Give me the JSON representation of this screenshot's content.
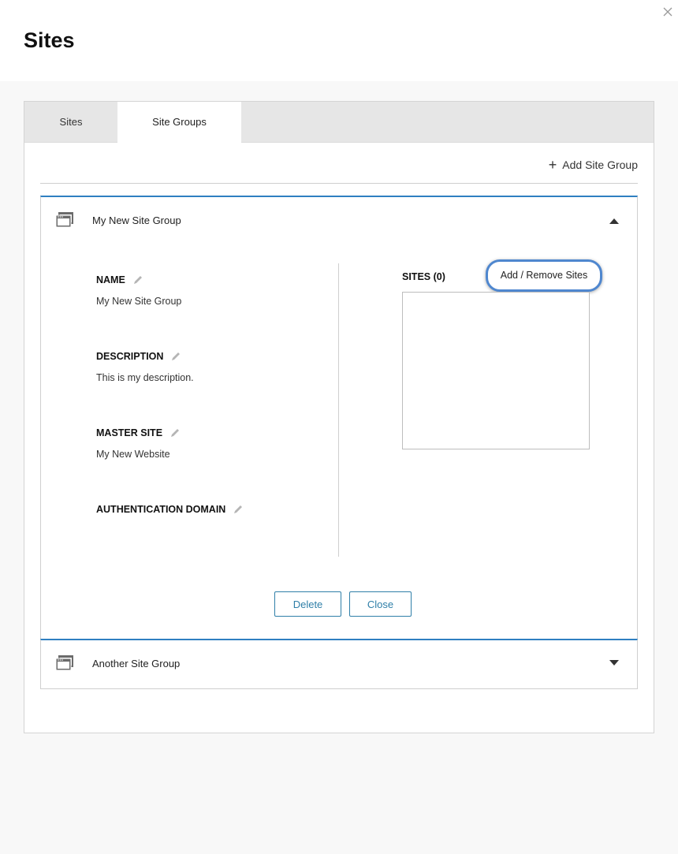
{
  "header": {
    "title": "Sites"
  },
  "tabs": [
    {
      "label": "Sites",
      "active": false
    },
    {
      "label": "Site Groups",
      "active": true
    }
  ],
  "toolbar": {
    "add_site_group_label": "Add Site Group"
  },
  "groups": [
    {
      "title": "My New Site Group",
      "expanded": true,
      "fields": [
        {
          "label": "NAME",
          "value": "My New Site Group"
        },
        {
          "label": "DESCRIPTION",
          "value": "This is my description."
        },
        {
          "label": "MASTER SITE",
          "value": "My New Website"
        },
        {
          "label": "AUTHENTICATION DOMAIN",
          "value": ""
        }
      ],
      "sites_label": "SITES (0)",
      "add_remove_label": "Add / Remove Sites",
      "delete_label": "Delete",
      "close_label": "Close"
    },
    {
      "title": "Another Site Group",
      "expanded": false
    }
  ],
  "colors": {
    "accent": "#2f7fc1",
    "highlight_ring": "#4f87cf",
    "button_text": "#2f7fa8"
  },
  "icons": {
    "close": "close-icon",
    "group": "window-stack-icon",
    "edit": "pencil-icon",
    "collapse": "caret-up-icon",
    "expand": "caret-down-icon"
  }
}
